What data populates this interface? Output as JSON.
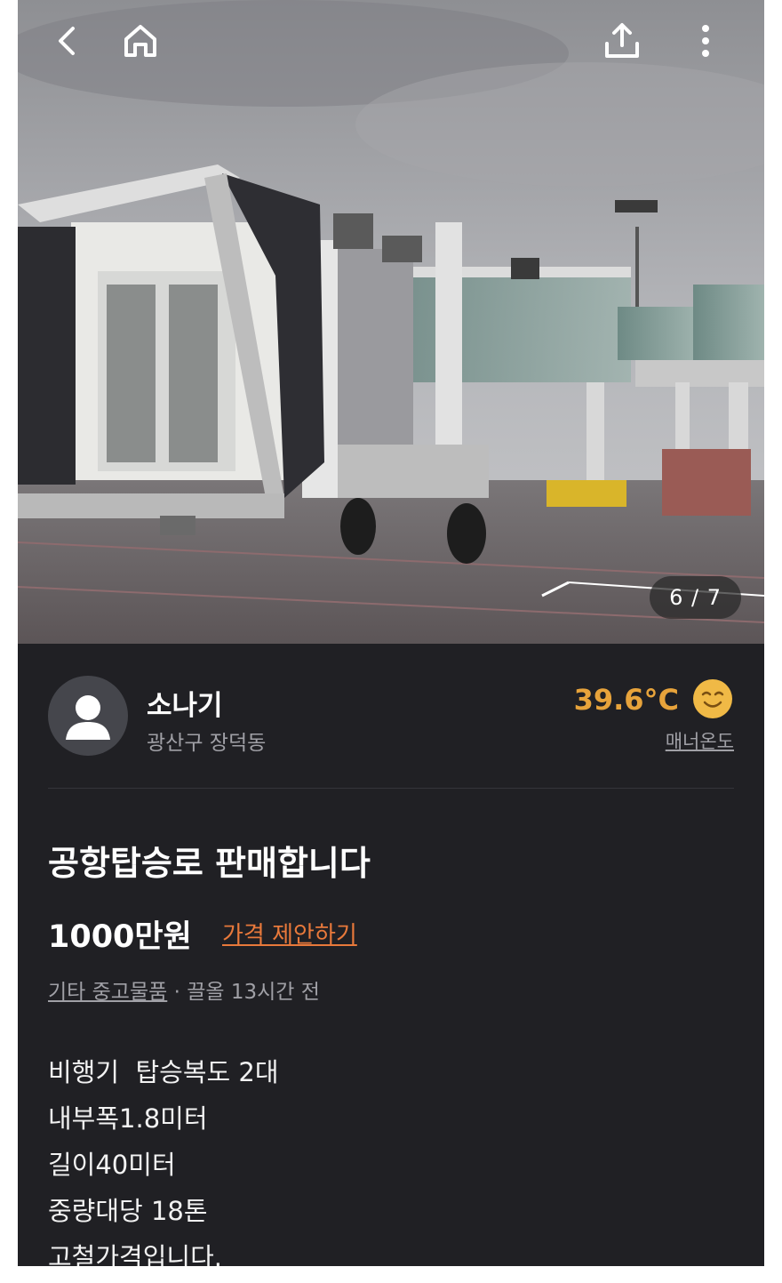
{
  "top_bar": {
    "icons": [
      "back-icon",
      "home-icon",
      "share-icon",
      "more-icon"
    ]
  },
  "photo": {
    "counter": "6 / 7"
  },
  "seller": {
    "name": "소나기",
    "location": "광산구 장덕동",
    "temperature": "39.6°C",
    "temperature_label": "매너온도"
  },
  "post": {
    "title": "공항탑승로 판매합니다",
    "price": "1000만원",
    "offer_label": "가격 제안하기",
    "category": "기타 중고물품",
    "meta_rest": " · 끌올 13시간 전",
    "description": "비행기  탑승복도 2대\n내부폭1.8미터\n길이40미터\n중량대당 18톤\n고철가격입니다."
  },
  "colors": {
    "accent": "#e8793b",
    "temperature": "#e7a33b",
    "background": "#202024"
  }
}
